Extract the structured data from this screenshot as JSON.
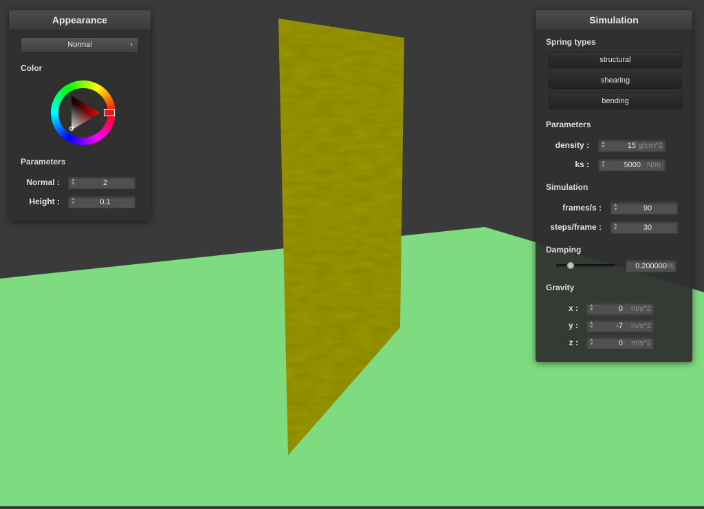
{
  "appearance": {
    "title": "Appearance",
    "shader_select": "Normal",
    "color_section": "Color",
    "color_value": "#cc1f22",
    "parameters_section": "Parameters",
    "normal_label": "Normal :",
    "normal_value": "2",
    "height_label": "Height :",
    "height_value": "0.1"
  },
  "simulation": {
    "title": "Simulation",
    "spring_types_section": "Spring types",
    "spring_buttons": [
      "structural",
      "shearing",
      "bending"
    ],
    "parameters_section": "Parameters",
    "density_label": "density :",
    "density_value": "15",
    "density_unit": "g/cm^2",
    "ks_label": "ks :",
    "ks_value": "5000",
    "ks_unit": "N/m",
    "simulation_section": "Simulation",
    "fps_label": "frames/s :",
    "fps_value": "90",
    "steps_label": "steps/frame :",
    "steps_value": "30",
    "damping_section": "Damping",
    "damping_value": "0.200000",
    "damping_unit": "%",
    "damping_level": 0.2,
    "gravity_section": "Gravity",
    "gx_label": "x :",
    "gx_value": "0",
    "gy_label": "y :",
    "gy_value": "-7",
    "gz_label": "z :",
    "gz_value": "0",
    "gravity_unit": "m/s^2"
  },
  "scene": {
    "wall_color": "#3a3a3a",
    "floor_color": "#7fdb7f",
    "cloth_color": "#9a9800"
  }
}
